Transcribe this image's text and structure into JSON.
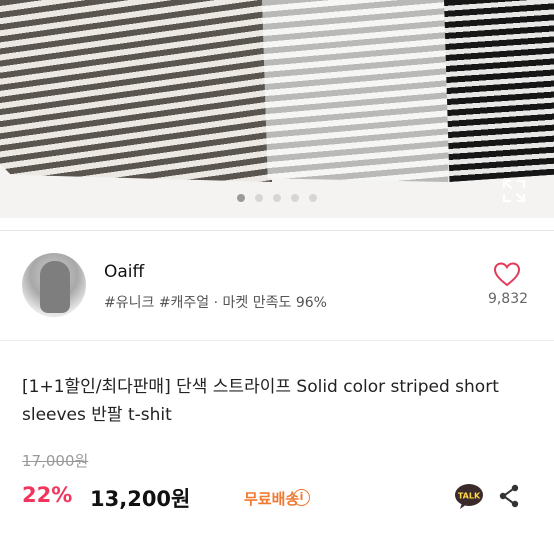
{
  "carousel": {
    "slide_count": 5,
    "active_index": 0,
    "images": [
      "brown striped shirt",
      "gray striped shirt",
      "black striped shirt"
    ]
  },
  "shop": {
    "name": "Oaiff",
    "tags": "#유니크 #캐주얼 · 마켓 만족도 96%",
    "like_count": "9,832"
  },
  "product": {
    "title": "[1+1할인/최다판매] 단색 스트라이프 Solid color striped short sleeves 반팔 t-shit",
    "original_price": "17,000원",
    "discount": "22%",
    "price": "13,200원",
    "shipping": "무료배송",
    "talk_label": "TALK"
  },
  "colors": {
    "discount": "#f2355e",
    "shipping": "#f07a32",
    "like": "#e23b5a",
    "talk_bg": "#3a2a2a"
  },
  "icons": [
    "expand-icon",
    "heart-icon",
    "info-icon",
    "talk-icon",
    "share-icon"
  ]
}
